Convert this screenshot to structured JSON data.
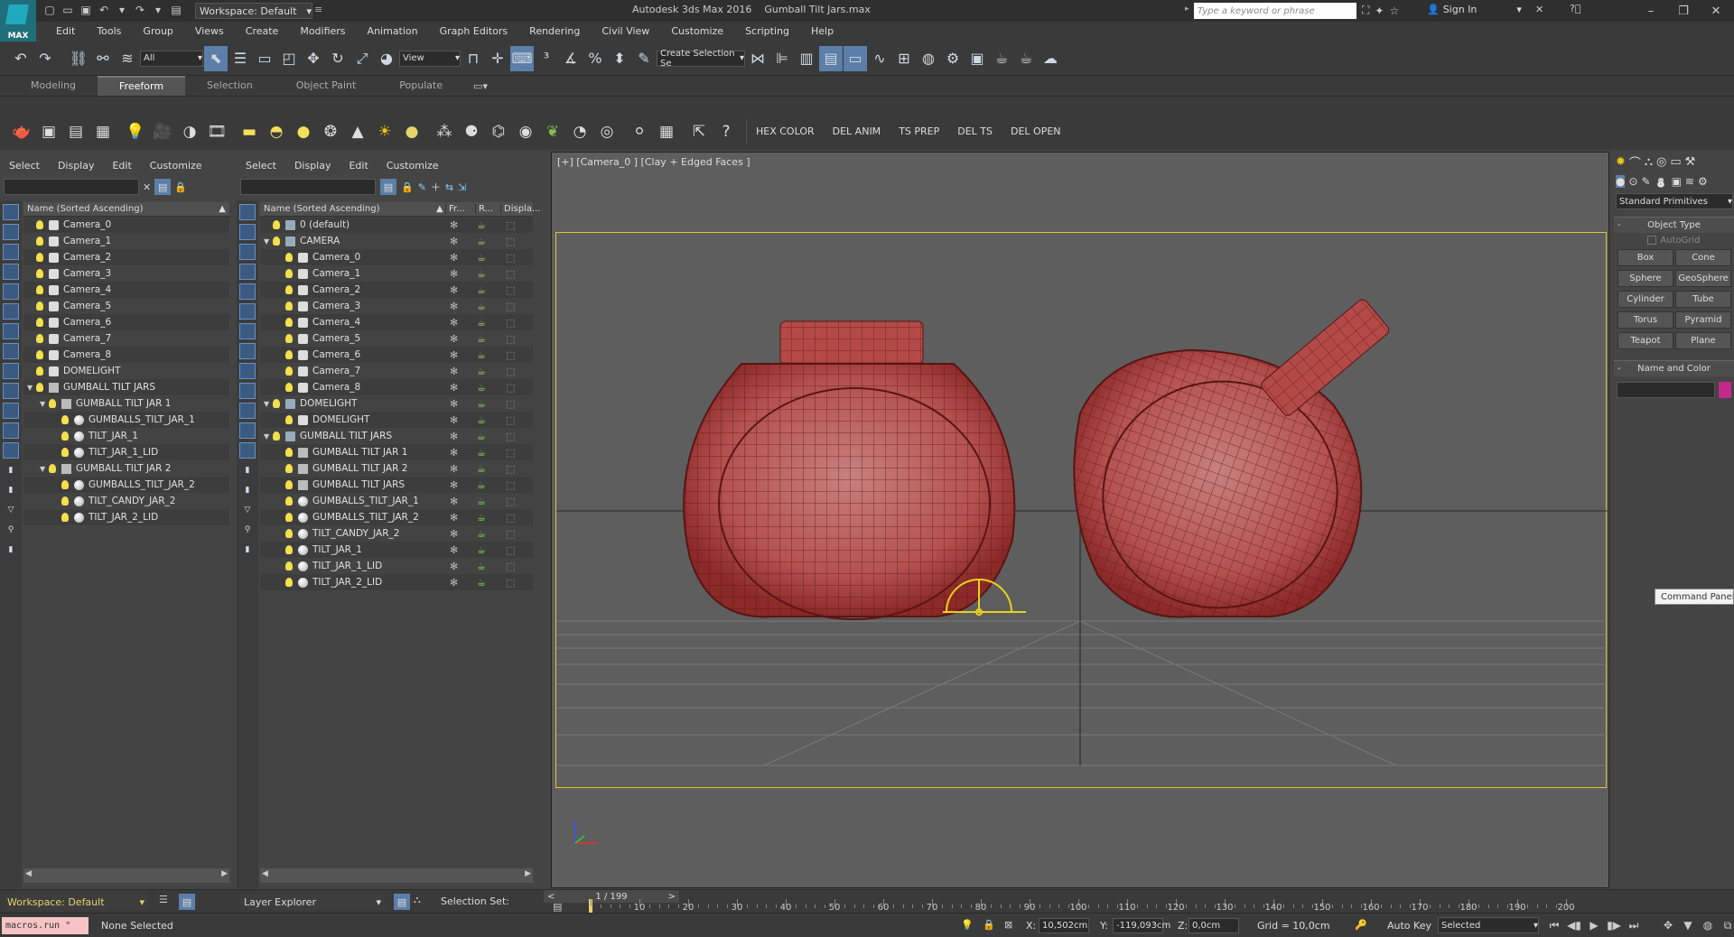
{
  "titlebar": {
    "logo_text": "MAX",
    "workspace_label": "Workspace: Default",
    "app_title": "Autodesk 3ds Max 2016",
    "file_name": "Gumball Tilt Jars.max",
    "search_placeholder": "Type a keyword or phrase",
    "sign_in": "Sign In"
  },
  "menubar": [
    "Edit",
    "Tools",
    "Group",
    "Views",
    "Create",
    "Modifiers",
    "Animation",
    "Graph Editors",
    "Rendering",
    "Civil View",
    "Customize",
    "Scripting",
    "Help"
  ],
  "maintoolbar": {
    "filter_value": "All",
    "refcoord_value": "View",
    "selection_set_value": "Create Selection Se"
  },
  "ribbon_tabs": [
    "Modeling",
    "Freeform",
    "Selection",
    "Object Paint",
    "Populate"
  ],
  "ribbon_active": "Freeform",
  "toolbar2": {
    "script_buttons": [
      "HEX COLOR",
      "DEL ANIM",
      "TS PREP",
      "DEL TS",
      "DEL OPEN"
    ]
  },
  "left_explorer": {
    "menu": [
      "Select",
      "Display",
      "Edit",
      "Customize"
    ],
    "header": "Name (Sorted Ascending)",
    "rows": [
      {
        "label": "Camera_0",
        "type": "cam",
        "indent": 0
      },
      {
        "label": "Camera_1",
        "type": "cam",
        "indent": 0
      },
      {
        "label": "Camera_2",
        "type": "cam",
        "indent": 0
      },
      {
        "label": "Camera_3",
        "type": "cam",
        "indent": 0
      },
      {
        "label": "Camera_4",
        "type": "cam",
        "indent": 0
      },
      {
        "label": "Camera_5",
        "type": "cam",
        "indent": 0
      },
      {
        "label": "Camera_6",
        "type": "cam",
        "indent": 0
      },
      {
        "label": "Camera_7",
        "type": "cam",
        "indent": 0
      },
      {
        "label": "Camera_8",
        "type": "cam",
        "indent": 0
      },
      {
        "label": "DOMELIGHT",
        "type": "cam",
        "indent": 0
      },
      {
        "label": "GUMBALL TILT JARS",
        "type": "grp",
        "indent": 0,
        "expand": true
      },
      {
        "label": "GUMBALL TILT JAR 1",
        "type": "grp",
        "indent": 1,
        "expand": true
      },
      {
        "label": "GUMBALLS_TILT_JAR_1",
        "type": "sph",
        "indent": 2
      },
      {
        "label": "TILT_JAR_1",
        "type": "sph",
        "indent": 2
      },
      {
        "label": "TILT_JAR_1_LID",
        "type": "sph",
        "indent": 2
      },
      {
        "label": "GUMBALL TILT JAR 2",
        "type": "grp",
        "indent": 1,
        "expand": true
      },
      {
        "label": "GUMBALLS_TILT_JAR_2",
        "type": "sph",
        "indent": 2
      },
      {
        "label": "TILT_CANDY_JAR_2",
        "type": "sph",
        "indent": 2
      },
      {
        "label": "TILT_JAR_2_LID",
        "type": "sph",
        "indent": 2
      }
    ],
    "workspace_footer": "Workspace: Default"
  },
  "layer_explorer": {
    "menu": [
      "Select",
      "Display",
      "Edit",
      "Customize"
    ],
    "headers": [
      "Name (Sorted Ascending)",
      "Fr...",
      "R...",
      "Displa..."
    ],
    "rows": [
      {
        "label": "0 (default)",
        "type": "lyr",
        "indent": 0
      },
      {
        "label": "CAMERA",
        "type": "lyr",
        "indent": 0,
        "expand": true
      },
      {
        "label": "Camera_0",
        "type": "cam",
        "indent": 1
      },
      {
        "label": "Camera_1",
        "type": "cam",
        "indent": 1
      },
      {
        "label": "Camera_2",
        "type": "cam",
        "indent": 1
      },
      {
        "label": "Camera_3",
        "type": "cam",
        "indent": 1
      },
      {
        "label": "Camera_4",
        "type": "cam",
        "indent": 1
      },
      {
        "label": "Camera_5",
        "type": "cam",
        "indent": 1
      },
      {
        "label": "Camera_6",
        "type": "cam",
        "indent": 1
      },
      {
        "label": "Camera_7",
        "type": "cam",
        "indent": 1
      },
      {
        "label": "Camera_8",
        "type": "cam",
        "indent": 1
      },
      {
        "label": "DOMELIGHT",
        "type": "lyr",
        "indent": 0,
        "expand": true
      },
      {
        "label": "DOMELIGHT",
        "type": "cam",
        "indent": 1
      },
      {
        "label": "GUMBALL TILT JARS",
        "type": "lyr",
        "indent": 0,
        "expand": true
      },
      {
        "label": "GUMBALL TILT JAR 1",
        "type": "grp",
        "indent": 1
      },
      {
        "label": "GUMBALL TILT JAR 2",
        "type": "grp",
        "indent": 1
      },
      {
        "label": "GUMBALL TILT JARS",
        "type": "grp",
        "indent": 1
      },
      {
        "label": "GUMBALLS_TILT_JAR_1",
        "type": "sph",
        "indent": 1
      },
      {
        "label": "GUMBALLS_TILT_JAR_2",
        "type": "sph",
        "indent": 1
      },
      {
        "label": "TILT_CANDY_JAR_2",
        "type": "sph",
        "indent": 1
      },
      {
        "label": "TILT_JAR_1",
        "type": "sph",
        "indent": 1
      },
      {
        "label": "TILT_JAR_1_LID",
        "type": "sph",
        "indent": 1
      },
      {
        "label": "TILT_JAR_2_LID",
        "type": "sph",
        "indent": 1
      }
    ],
    "footer_label": "Layer Explorer",
    "selection_set_label": "Selection Set:"
  },
  "viewport": {
    "label": "[+] [Camera_0 ] [Clay + Edged Faces ]"
  },
  "command_panel": {
    "category": "Standard Primitives",
    "object_type_title": "Object Type",
    "autogrid": "AutoGrid",
    "buttons": [
      "Box",
      "Cone",
      "Sphere",
      "GeoSphere",
      "Cylinder",
      "Tube",
      "Torus",
      "Pyramid",
      "Teapot",
      "Plane"
    ],
    "name_color_title": "Name and Color",
    "swatch_color": "#c4298a",
    "tooltip": "Command Panel"
  },
  "timeline": {
    "frame_display": "1 / 199",
    "ticks": [
      10,
      20,
      30,
      40,
      50,
      60,
      70,
      80,
      90,
      100,
      110,
      120,
      130,
      140,
      150,
      160,
      170,
      180,
      190,
      200
    ]
  },
  "statusbar": {
    "maxscript": "macros.run \"",
    "status": "None Selected",
    "x_label": "X:",
    "x_value": "10,502cm",
    "y_label": "Y:",
    "y_value": "-119,093cm",
    "z_label": "Z:",
    "z_value": "0,0cm",
    "grid": "Grid = 10,0cm",
    "autokey": "Auto Key",
    "autokey_mode": "Selected"
  },
  "colors": {
    "jar": "#b44a48",
    "wire": "#5a1414",
    "safeframe": "#d9c82a"
  }
}
